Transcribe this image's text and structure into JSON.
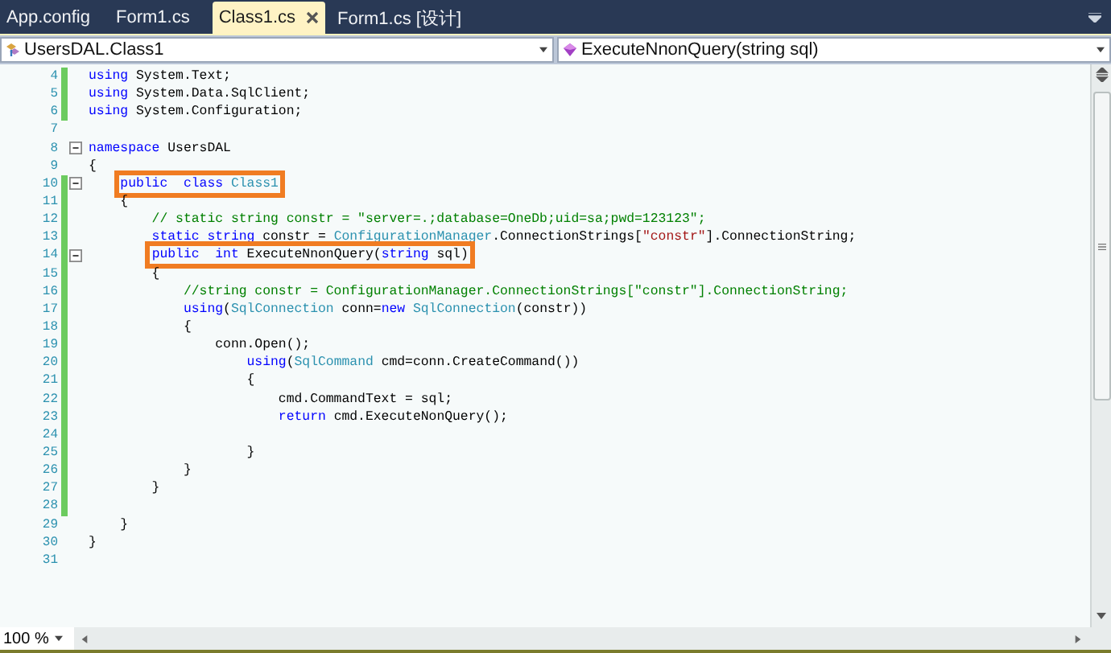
{
  "tabs": [
    {
      "label": "App.config",
      "selected": false
    },
    {
      "label": "Form1.cs",
      "selected": false
    },
    {
      "label": "Class1.cs",
      "selected": true
    },
    {
      "label": "Form1.cs [设计]",
      "selected": false
    }
  ],
  "navigation": {
    "type_combo": {
      "value": "UsersDAL.Class1"
    },
    "member_combo": {
      "value": "ExecuteNnonQuery(string sql)"
    }
  },
  "lines": [
    {
      "number": "4",
      "changed": true,
      "fold": false,
      "boxed": false,
      "tokens": [
        {
          "kind": "keyword",
          "text": "using"
        },
        {
          "kind": "plain",
          "text": " System.Text;"
        }
      ]
    },
    {
      "number": "5",
      "changed": true,
      "fold": false,
      "boxed": false,
      "tokens": [
        {
          "kind": "keyword",
          "text": "using"
        },
        {
          "kind": "plain",
          "text": " System.Data.SqlClient;"
        }
      ]
    },
    {
      "number": "6",
      "changed": true,
      "fold": false,
      "boxed": false,
      "tokens": [
        {
          "kind": "keyword",
          "text": "using"
        },
        {
          "kind": "plain",
          "text": " System.Configuration;"
        }
      ]
    },
    {
      "number": "7",
      "changed": false,
      "fold": false
    },
    {
      "number": "8",
      "changed": false,
      "fold": true,
      "boxed": false,
      "tokens": [
        {
          "kind": "keyword",
          "text": "namespace"
        },
        {
          "kind": "plain",
          "text": " UsersDAL"
        }
      ]
    },
    {
      "number": "9",
      "changed": false,
      "fold": false,
      "boxed": false,
      "tokens": [
        {
          "kind": "plain",
          "text": "{"
        }
      ]
    },
    {
      "number": "10",
      "changed": true,
      "fold": true,
      "boxed": true,
      "tokens": [
        {
          "kind": "keyword",
          "text": "    public  "
        },
        {
          "kind": "keyword",
          "text": "class "
        },
        {
          "kind": "type",
          "text": "Class1"
        }
      ]
    },
    {
      "number": "11",
      "changed": true,
      "fold": false,
      "boxed": false,
      "tokens": [
        {
          "kind": "plain",
          "text": "    {"
        }
      ]
    },
    {
      "number": "12",
      "changed": true,
      "fold": false,
      "boxed": false,
      "tokens": [
        {
          "kind": "comment",
          "text": "        // static string constr = \"server=.;database=OneDb;uid=sa;pwd=123123\";"
        }
      ]
    },
    {
      "number": "13",
      "changed": true,
      "fold": false,
      "boxed": false,
      "tokens": [
        {
          "kind": "keyword",
          "text": "        static "
        },
        {
          "kind": "keyword",
          "text": "string"
        },
        {
          "kind": "plain",
          "text": " constr = "
        },
        {
          "kind": "type",
          "text": "ConfigurationManager"
        },
        {
          "kind": "plain",
          "text": ".ConnectionStrings["
        },
        {
          "kind": "string",
          "text": "\"constr\""
        },
        {
          "kind": "plain",
          "text": "].ConnectionString;"
        }
      ]
    },
    {
      "number": "14",
      "changed": true,
      "fold": true,
      "boxed": true,
      "tokens": [
        {
          "kind": "keyword",
          "text": "        public  "
        },
        {
          "kind": "keyword",
          "text": "int"
        },
        {
          "kind": "plain",
          "text": " ExecuteNnonQuery("
        },
        {
          "kind": "keyword",
          "text": "string"
        },
        {
          "kind": "plain",
          "text": " sql)"
        }
      ]
    },
    {
      "number": "15",
      "changed": true,
      "fold": false,
      "boxed": false,
      "tokens": [
        {
          "kind": "plain",
          "text": "        {"
        }
      ]
    },
    {
      "number": "16",
      "changed": true,
      "fold": false,
      "boxed": false,
      "tokens": [
        {
          "kind": "comment",
          "text": "            //string constr = ConfigurationManager.ConnectionStrings[\"constr\"].ConnectionString;"
        }
      ]
    },
    {
      "number": "17",
      "changed": true,
      "fold": false,
      "boxed": false,
      "tokens": [
        {
          "kind": "keyword",
          "text": "            using"
        },
        {
          "kind": "plain",
          "text": "("
        },
        {
          "kind": "type",
          "text": "SqlConnection"
        },
        {
          "kind": "plain",
          "text": " conn="
        },
        {
          "kind": "keyword",
          "text": "new "
        },
        {
          "kind": "type",
          "text": "SqlConnection"
        },
        {
          "kind": "plain",
          "text": "(constr))"
        }
      ]
    },
    {
      "number": "18",
      "changed": true,
      "fold": false,
      "boxed": false,
      "tokens": [
        {
          "kind": "plain",
          "text": "            {"
        }
      ]
    },
    {
      "number": "19",
      "changed": true,
      "fold": false,
      "boxed": false,
      "tokens": [
        {
          "kind": "plain",
          "text": "                conn.Open();"
        }
      ]
    },
    {
      "number": "20",
      "changed": true,
      "fold": false,
      "boxed": false,
      "tokens": [
        {
          "kind": "keyword",
          "text": "                    using"
        },
        {
          "kind": "plain",
          "text": "("
        },
        {
          "kind": "type",
          "text": "SqlCommand"
        },
        {
          "kind": "plain",
          "text": " cmd=conn.CreateCommand())"
        }
      ]
    },
    {
      "number": "21",
      "changed": true,
      "fold": false,
      "boxed": false,
      "tokens": [
        {
          "kind": "plain",
          "text": "                    {"
        }
      ]
    },
    {
      "number": "22",
      "changed": true,
      "fold": false,
      "boxed": false,
      "tokens": [
        {
          "kind": "plain",
          "text": "                        cmd.CommandText = sql;"
        }
      ]
    },
    {
      "number": "23",
      "changed": true,
      "fold": false,
      "boxed": false,
      "tokens": [
        {
          "kind": "keyword",
          "text": "                        return"
        },
        {
          "kind": "plain",
          "text": " cmd.ExecuteNonQuery();"
        }
      ]
    },
    {
      "number": "24",
      "changed": true,
      "fold": false
    },
    {
      "number": "25",
      "changed": true,
      "fold": false,
      "boxed": false,
      "tokens": [
        {
          "kind": "plain",
          "text": "                    }"
        }
      ]
    },
    {
      "number": "26",
      "changed": true,
      "fold": false,
      "boxed": false,
      "tokens": [
        {
          "kind": "plain",
          "text": "            }"
        }
      ]
    },
    {
      "number": "27",
      "changed": true,
      "fold": false,
      "boxed": false,
      "tokens": [
        {
          "kind": "plain",
          "text": "        }"
        }
      ]
    },
    {
      "number": "28",
      "changed": true,
      "fold": false
    },
    {
      "number": "29",
      "changed": false,
      "fold": false,
      "boxed": false,
      "tokens": [
        {
          "kind": "plain",
          "text": "    }"
        }
      ]
    },
    {
      "number": "30",
      "changed": false,
      "fold": false,
      "boxed": false,
      "tokens": [
        {
          "kind": "plain",
          "text": "}"
        }
      ]
    },
    {
      "number": "31",
      "changed": false,
      "fold": false
    }
  ],
  "zoom": "100 %"
}
